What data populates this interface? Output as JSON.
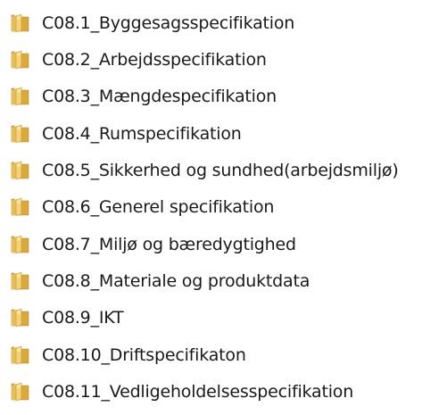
{
  "folders": [
    {
      "name": "C08.1_Byggesagsspecifikation"
    },
    {
      "name": "C08.2_Arbejdsspecifikation"
    },
    {
      "name": "C08.3_Mængdespecifikation"
    },
    {
      "name": "C08.4_Rumspecifikation"
    },
    {
      "name": "C08.5_Sikkerhed og sundhed(arbejdsmiljø)"
    },
    {
      "name": "C08.6_Generel specifikation"
    },
    {
      "name": "C08.7_Miljø og bæredygtighed"
    },
    {
      "name": "C08.8_Materiale og produktdata"
    },
    {
      "name": "C08.9_IKT"
    },
    {
      "name": "C08.10_Driftspecifikaton"
    },
    {
      "name": "C08.11_Vedligeholdelsesspecifikation"
    }
  ],
  "icon": "folder-icon",
  "colors": {
    "folder_back": "#d9a93a",
    "folder_front": "#f3d27a",
    "folder_highlight": "#fbe6a6",
    "text": "#1a1a1a"
  }
}
